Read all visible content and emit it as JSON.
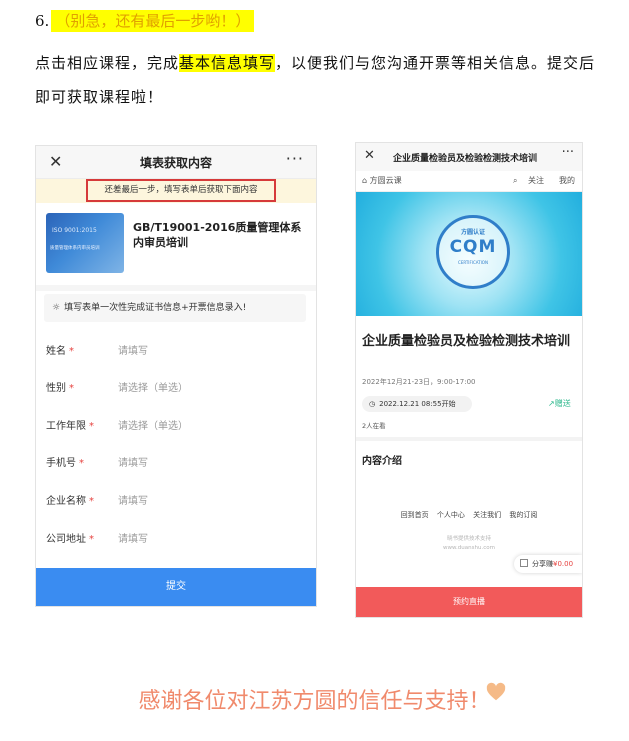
{
  "step": {
    "number": "6.",
    "highlight": "（别急，还有最后一步哟！）"
  },
  "intro": {
    "before": "点击相应课程，完成",
    "highlight": "基本信息填写",
    "after": "，以便我们与您沟通开票等相关信息。提交后即可获取课程啦！"
  },
  "left_phone": {
    "title": "填表获取内容",
    "close_icon": "✕",
    "more_icon": "···",
    "notice": "还差最后一步，填写表单后获取下面内容",
    "thumb_text": "ISO 9001:2015",
    "thumb_sub": "质量管理体系内审员培训",
    "course_title": "GB/T19001-2016质量管理体系内审员培训",
    "tip": "填写表单一次性完成证书信息+开票信息录入!",
    "fields": [
      {
        "label": "姓名",
        "required": "*",
        "placeholder": "请填写"
      },
      {
        "label": "性别",
        "required": "*",
        "placeholder": "请选择（单选）"
      },
      {
        "label": "工作年限",
        "required": "*",
        "placeholder": "请选择（单选）"
      },
      {
        "label": "手机号",
        "required": "*",
        "placeholder": "请填写"
      },
      {
        "label": "企业名称",
        "required": "*",
        "placeholder": "请填写"
      },
      {
        "label": "公司地址",
        "required": "*",
        "placeholder": "请填写"
      }
    ],
    "submit": "提交",
    "colors": {
      "submit_bg": "#3a8cf1",
      "notice_border": "#d63a3a"
    }
  },
  "right_phone": {
    "title": "企业质量检验员及检验检测技术培训",
    "close_icon": "✕",
    "more_icon": "···",
    "home_label": "方圆云课",
    "follow_label": "关注",
    "mine_label": "我的",
    "badge_top": "方圆认证",
    "badge_logo": "CQM",
    "badge_bottom": "CERTIFICATION",
    "course_title": "企业质量检验员及检验检测技术培训",
    "date_range": "2022年12月21-23日，9:00-17:00",
    "start_time": "2022.12.21 08:55开始",
    "gift": "赠送",
    "viewers": "2人在看",
    "section_title": "内容介绍",
    "links": [
      "回到首页",
      "个人中心",
      "关注我们",
      "我的订阅"
    ],
    "credit_line1": "晓书提供技术支持",
    "credit_line2": "www.duanshu.com",
    "share_label": "分享赚",
    "share_price": "¥0.00",
    "book_button": "预约直播",
    "colors": {
      "book_bg": "#f25a5a",
      "gift": "#2eb88d"
    }
  },
  "thanks": "感谢各位对江苏方圆的信任与支持！"
}
